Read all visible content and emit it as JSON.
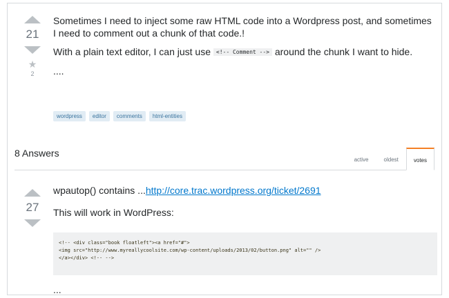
{
  "question": {
    "score": "21",
    "favorite_count": "2",
    "paragraph1": "Sometimes I need to inject some raw HTML code into a Wordpress post, and sometimes I need to comment out a chunk of that code.!",
    "paragraph2_before": "With a plain text editor, I can just use ",
    "paragraph2_code": "<!-- Comment -->",
    "paragraph2_after": " around the chunk I want to hide.",
    "ellipsis": "....",
    "tags": [
      "wordpress",
      "editor",
      "comments",
      "html-entities"
    ]
  },
  "answers_header": {
    "count_label": "8 Answers",
    "tabs": [
      "active",
      "oldest",
      "votes"
    ],
    "selected_tab": "votes"
  },
  "answer": {
    "score": "27",
    "line1_text": "wpautop() contains ...",
    "line1_link": "http://core.trac.wordpress.org/ticket/2691",
    "line2": "This will work in WordPress:",
    "code": "<!-- <div class=\"book floatleft\"><a href=\"#\">\n<img src=\"http://www.myreallycoolsite.com/wp-content/uploads/2013/02/button.png\" alt=\"\" />\n</a></div> <!-- -->",
    "ellipsis": "..."
  },
  "colors": {
    "link": "#0077cc",
    "accent": "#f48024",
    "tag_bg": "#e1ecf4"
  }
}
